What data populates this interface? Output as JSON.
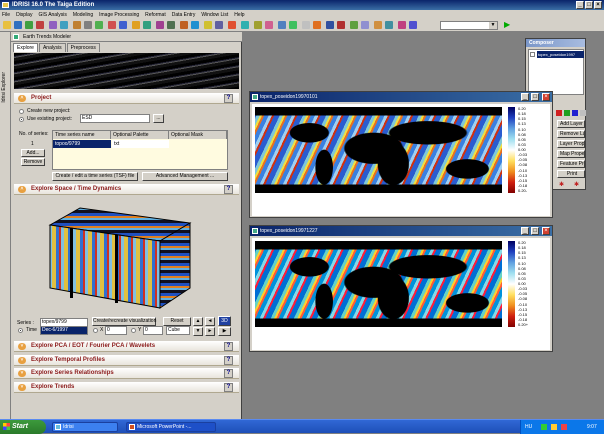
{
  "app": {
    "title": "IDRISI 16.0     The Taiga Edition"
  },
  "menu": [
    "File",
    "Display",
    "GIS Analysis",
    "Modeling",
    "Image Processing",
    "Reformat",
    "Data Entry",
    "Window List",
    "Help"
  ],
  "side_strip": {
    "label": "Idrisi Explorer"
  },
  "etm": {
    "title": "Earth Trends Modeler",
    "tabs": [
      "Explore",
      "Analysis",
      "Preprocess"
    ],
    "project": {
      "header": "Project",
      "help": "?",
      "create": "Create new project:",
      "use": "Use existing project:",
      "project_value": "ESD",
      "browse": "...",
      "series_label": "No. of series:",
      "series_count": "1",
      "add": "Add...",
      "remove": "Remove",
      "cols": [
        "Time series name",
        "Optional Palette",
        "Optional Mask"
      ],
      "row": {
        "name": "topoo/9799",
        "palette": "txt"
      },
      "create_btn": "Create / edit a time series (TSF) file",
      "adv_btn": "Advanced Management ..."
    },
    "space": {
      "header": "Explore Space / Time Dynamics",
      "help": "?",
      "series_lbl": "Series :",
      "series_val": "topex/9799",
      "recreate": "Create/recreate visualization",
      "reset": "Reset",
      "time_lbl": "Time",
      "time_val": "Dec-6/1997",
      "x_lbl": "X",
      "x_val": "0",
      "y_lbl": "Y",
      "y_val": "0",
      "shape_val": "Cube"
    },
    "sections": [
      {
        "label": "Explore PCA / EOT / Fourier PCA / Wavelets",
        "help": "?"
      },
      {
        "label": "Explore Temporal Profiles",
        "help": "?"
      },
      {
        "label": "Explore Series Relationships",
        "help": "?"
      },
      {
        "label": "Explore Trends",
        "help": "?"
      }
    ]
  },
  "maps": [
    {
      "title": "topex_poseidon19970101",
      "ticks": [
        "0.20",
        "0.18",
        "0.15",
        "0.13",
        "0.10",
        "0.08",
        "0.05",
        "0.03",
        "0.00",
        "-0.03",
        "-0.05",
        "-0.08",
        "-0.10",
        "-0.13",
        "-0.15",
        "-0.18",
        "0.20-"
      ]
    },
    {
      "title": "topex_poseidon19971227",
      "ticks": [
        "0.20",
        "0.18",
        "0.15",
        "0.13",
        "0.10",
        "0.08",
        "0.05",
        "0.03",
        "0.00",
        "-0.03",
        "-0.05",
        "-0.08",
        "-0.10",
        "-0.13",
        "-0.15",
        "-0.18",
        "0.20+"
      ]
    }
  ],
  "composer": {
    "title": "Composer",
    "layer": "topex_poseidon1997",
    "buttons": [
      "Add Layer",
      "Remove Layer",
      "Layer Properties",
      "Map Properties",
      "Feature Properties",
      "Print"
    ]
  },
  "taskbar": {
    "start": "Start",
    "tasks": [
      "Idrisi",
      "Microsoft PowerPoint -..."
    ],
    "lang": "HU",
    "clock": "9:07"
  }
}
